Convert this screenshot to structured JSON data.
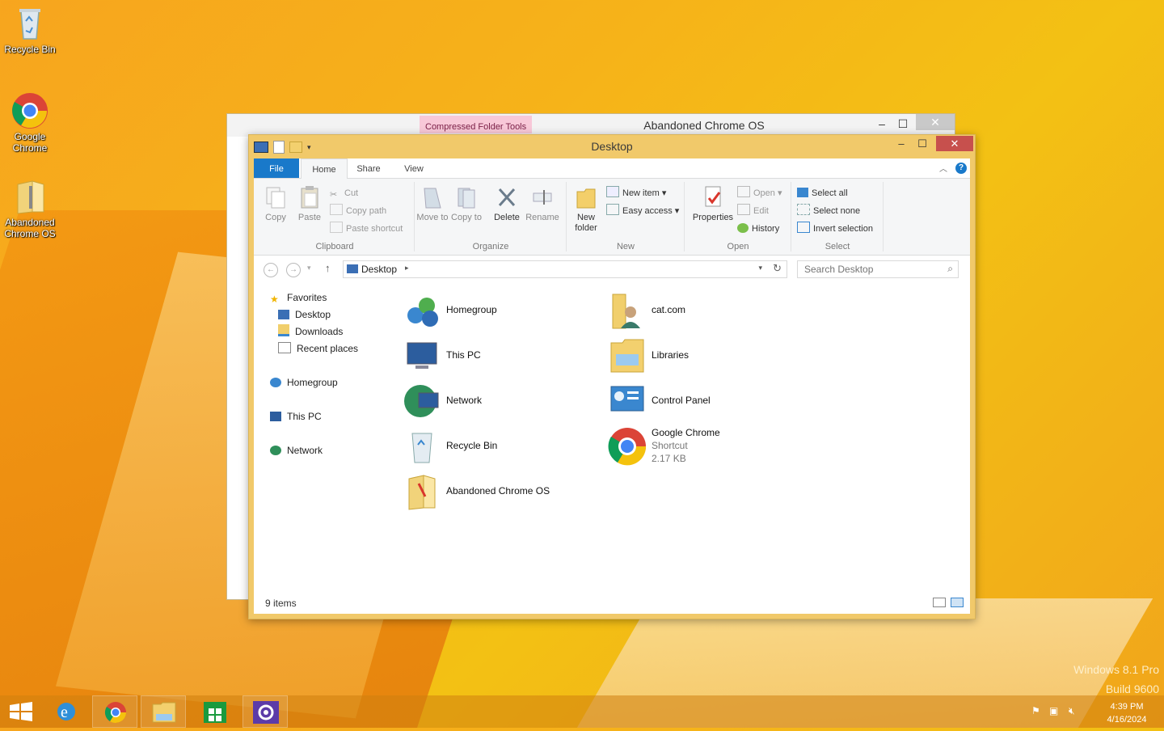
{
  "desktop": {
    "icons": [
      {
        "label": "Recycle Bin",
        "icon": "recycle-bin-icon"
      },
      {
        "label": "Google Chrome",
        "icon": "chrome-icon"
      },
      {
        "label": "Abandoned Chrome OS",
        "icon": "zip-folder-icon"
      }
    ],
    "watermark": {
      "line1": "Windows 8.1 Pro",
      "line2": "Build 9600"
    }
  },
  "back_window": {
    "contextual_tab": "Compressed Folder Tools",
    "title": "Abandoned Chrome OS",
    "controls": {
      "min": "–",
      "max": "☐",
      "close": "✕"
    }
  },
  "window": {
    "title": "Desktop",
    "controls": {
      "min": "–",
      "max": "☐",
      "close": "✕"
    },
    "tabs": {
      "file": "File",
      "home": "Home",
      "share": "Share",
      "view": "View"
    },
    "ribbon": {
      "clipboard": {
        "label": "Clipboard",
        "copy": "Copy",
        "paste": "Paste",
        "cut": "Cut",
        "copy_path": "Copy path",
        "paste_shortcut": "Paste shortcut"
      },
      "organize": {
        "label": "Organize",
        "move_to": "Move to",
        "copy_to": "Copy to",
        "delete": "Delete",
        "rename": "Rename"
      },
      "new": {
        "label": "New",
        "new_folder": "New folder",
        "new_item": "New item",
        "easy_access": "Easy access"
      },
      "open": {
        "label": "Open",
        "properties": "Properties",
        "open": "Open",
        "edit": "Edit",
        "history": "History"
      },
      "select": {
        "label": "Select",
        "select_all": "Select all",
        "select_none": "Select none",
        "invert_selection": "Invert selection"
      }
    },
    "address": {
      "location": "Desktop",
      "search_placeholder": "Search Desktop"
    },
    "nav": {
      "favorites": "Favorites",
      "desktop": "Desktop",
      "downloads": "Downloads",
      "recent_places": "Recent places",
      "homegroup": "Homegroup",
      "this_pc": "This PC",
      "network": "Network"
    },
    "items": [
      {
        "name": "Homegroup",
        "icon": "homegroup-icon"
      },
      {
        "name": "This PC",
        "icon": "this-pc-icon"
      },
      {
        "name": "Network",
        "icon": "network-icon"
      },
      {
        "name": "Recycle Bin",
        "icon": "recycle-bin-icon"
      },
      {
        "name": "Abandoned Chrome OS",
        "icon": "zip-folder-icon"
      },
      {
        "name": "cat.com",
        "icon": "user-folder-icon"
      },
      {
        "name": "Libraries",
        "icon": "libraries-icon"
      },
      {
        "name": "Control Panel",
        "icon": "control-panel-icon"
      },
      {
        "name": "Google Chrome",
        "icon": "chrome-icon",
        "type": "Shortcut",
        "size": "2.17 KB"
      }
    ],
    "status": {
      "count": "9 items"
    }
  },
  "taskbar": {
    "items": [
      "start-icon",
      "internet-explorer-icon",
      "chrome-icon",
      "file-explorer-icon",
      "store-icon",
      "settings-icon"
    ],
    "clock": {
      "time": "4:39 PM",
      "date": "4/16/2024"
    }
  },
  "colors": {
    "accent": "#1979ca",
    "window_frame": "#f1c96a",
    "close": "#c7504d"
  }
}
